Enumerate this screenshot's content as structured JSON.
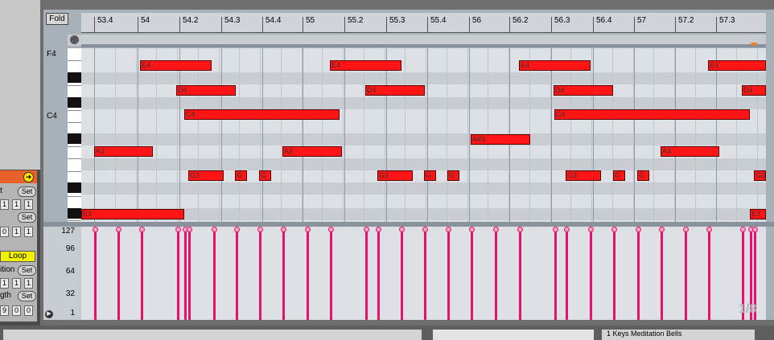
{
  "toolbar": {
    "fold_label": "Fold"
  },
  "ruler": {
    "labels": [
      "53.4",
      "54",
      "54.2",
      "54.3",
      "54.4",
      "55",
      "55.2",
      "55.3",
      "55.4",
      "56",
      "56.2",
      "56.3",
      "56.4",
      "57",
      "57.2",
      "57.3"
    ]
  },
  "keys": {
    "upper": "F4",
    "middle": "C4"
  },
  "left_panel": {
    "props": [
      {
        "label": "t",
        "set": "Set",
        "values": []
      },
      {
        "label": "",
        "set": "",
        "values": [
          "1",
          "1",
          "1"
        ]
      },
      {
        "label": "",
        "set": "Set",
        "values": []
      },
      {
        "label": "",
        "set": "",
        "values": [
          "0",
          "1",
          "1"
        ]
      },
      {
        "label": "Loop",
        "set": "",
        "values": []
      },
      {
        "label": "ition",
        "set": "Set",
        "values": []
      },
      {
        "label": "",
        "set": "",
        "values": [
          "1",
          "1",
          "1"
        ]
      },
      {
        "label": "gth",
        "set": "Set",
        "values": []
      },
      {
        "label": "",
        "set": "",
        "values": [
          "9",
          "0",
          "0"
        ]
      }
    ]
  },
  "notes": [
    {
      "label": "E3"
    },
    {
      "label": "A3"
    },
    {
      "label": "E4"
    },
    {
      "label": "D4"
    },
    {
      "label": "C4"
    },
    {
      "label": "G3"
    },
    {
      "label": "G"
    },
    {
      "label": "G"
    },
    {
      "label": "A3"
    },
    {
      "label": "E4"
    },
    {
      "label": "D4"
    },
    {
      "label": "G3"
    },
    {
      "label": "G"
    },
    {
      "label": "G"
    },
    {
      "label": "A#3"
    },
    {
      "label": "E4"
    },
    {
      "label": "D4"
    },
    {
      "label": "C4"
    },
    {
      "label": "G3"
    },
    {
      "label": "G"
    },
    {
      "label": "G"
    },
    {
      "label": "A3"
    },
    {
      "label": "E4"
    },
    {
      "label": "D4"
    },
    {
      "label": "E3"
    },
    {
      "label": "G3"
    }
  ],
  "velocity": {
    "labels": [
      "127",
      "96",
      "64",
      "32",
      "1"
    ]
  },
  "quantize": "1/8",
  "bottom": {
    "left_text": "",
    "right_text": "1 Keys Meditation Bells"
  },
  "colors": {
    "note": "#ff1515",
    "velocity": "#e8106a",
    "loop": "#f2f200",
    "clip_header": "#e8602a"
  }
}
